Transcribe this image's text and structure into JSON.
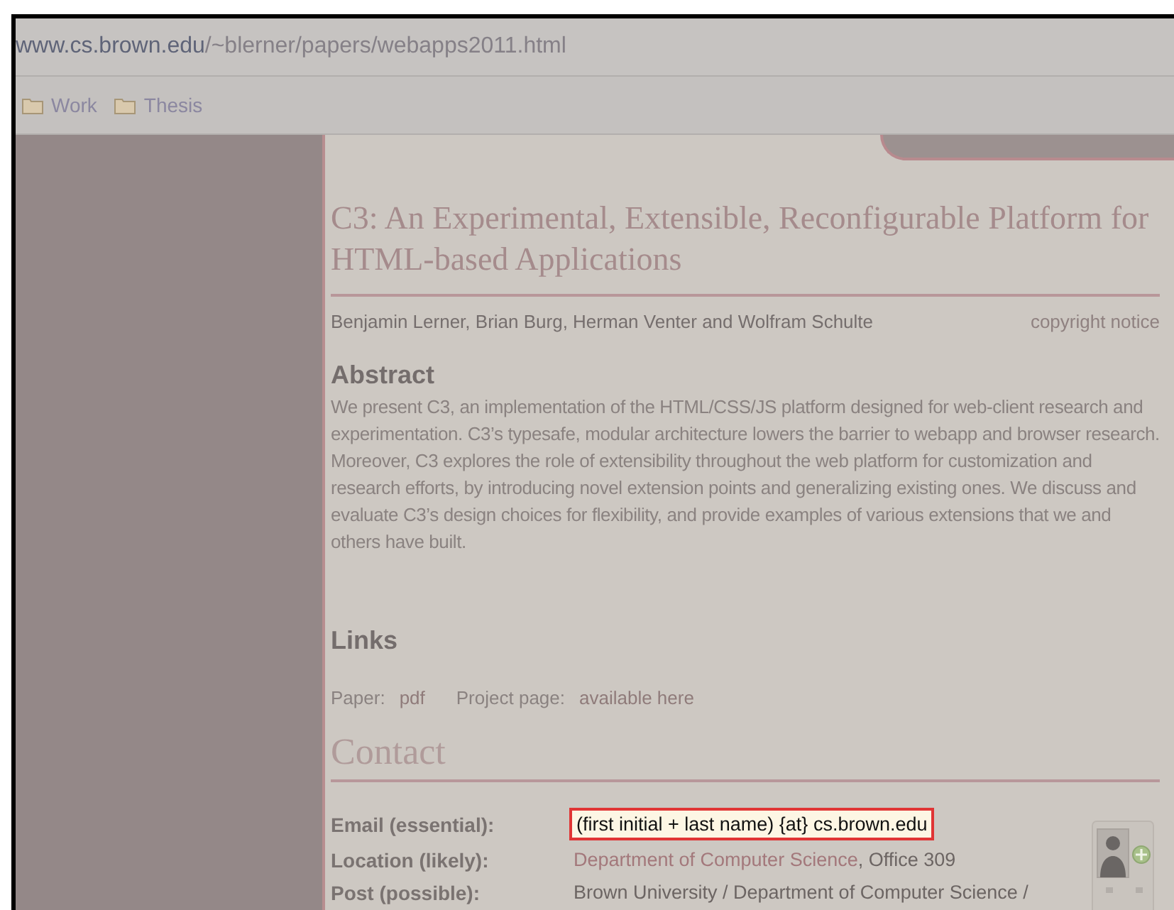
{
  "browser": {
    "url_host": "www.cs.brown.edu",
    "url_path": "/~blerner/papers/webapps2011.html",
    "bookmarks": [
      "Work",
      "Thesis"
    ]
  },
  "page": {
    "title": "C3: An Experimental, Extensible, Reconfigurable Platform for HTML-based Applications",
    "authors": "Benjamin Lerner, Brian Burg, Herman Venter and Wolfram Schulte",
    "copyright_link": "copyright notice",
    "abstract_heading": "Abstract",
    "abstract": "We present C3, an implementation of the HTML/CSS/JS platform designed for web-client research and experimentation. C3’s typesafe, modular architecture lowers the barrier to webapp and browser research. Moreover, C3 explores the role of extensibility throughout the web platform for customization and research efforts, by introducing novel extension points and generalizing existing ones. We discuss and evaluate C3’s design choices for flexibility, and provide examples of various extensions that we and others have built.",
    "links_heading": "Links",
    "links": [
      {
        "label": "Paper:",
        "link": "pdf"
      },
      {
        "label": "Project page:",
        "link": "available here"
      }
    ],
    "contact_heading": "Contact",
    "contact": [
      {
        "label": "Email (essential):",
        "highlighted": true,
        "parts": [
          {
            "text": "(first initial + last name) {at} cs.brown.edu",
            "link": false
          }
        ]
      },
      {
        "label": "Location (likely):",
        "highlighted": false,
        "parts": [
          {
            "text": "Department of Computer Science",
            "link": true
          },
          {
            "text": ", Office 309",
            "link": false
          }
        ]
      },
      {
        "label": "Post (possible):",
        "highlighted": false,
        "parts": [
          {
            "text": "Brown University / Department of Computer Science /",
            "link": false
          }
        ]
      }
    ]
  }
}
